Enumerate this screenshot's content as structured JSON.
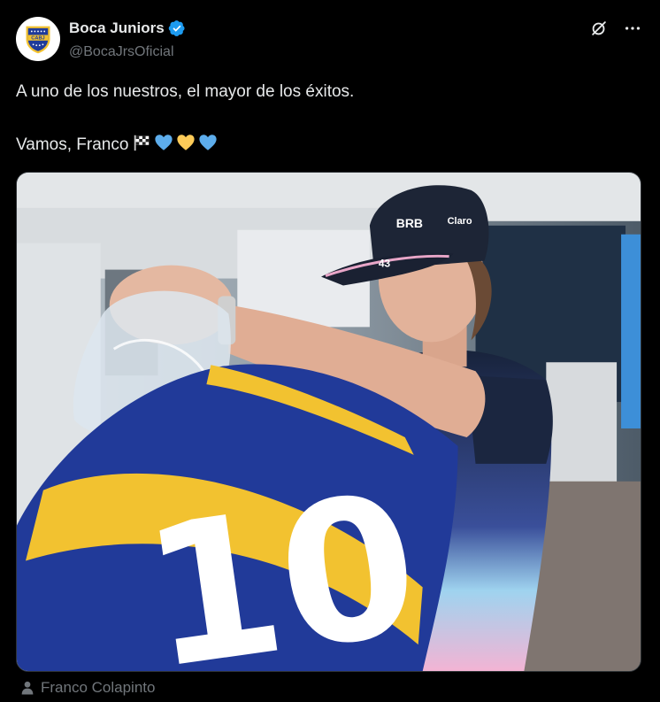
{
  "post": {
    "author": {
      "display_name": "Boca Juniors",
      "handle": "@BocaJrsOficial",
      "avatar_text": "CABJ",
      "verified": true
    },
    "text": {
      "line1": "A uno de los nuestros, el mayor de los éxitos.",
      "line2": "Vamos, Franco"
    },
    "emojis": [
      "chequered-flag",
      "blue-heart",
      "yellow-heart",
      "blue-heart"
    ],
    "media": {
      "jersey_number": "10",
      "cap_number": "43",
      "cap_logo": "BRB",
      "cap_sponsor": "Claro"
    },
    "tagged_user": "Franco Colapinto"
  },
  "colors": {
    "background": "#000000",
    "text_primary": "#e7e9ea",
    "text_secondary": "#71767b",
    "verified_blue": "#1d9bf0",
    "boca_blue": "#1f3b9a",
    "boca_yellow": "#f2c230"
  }
}
